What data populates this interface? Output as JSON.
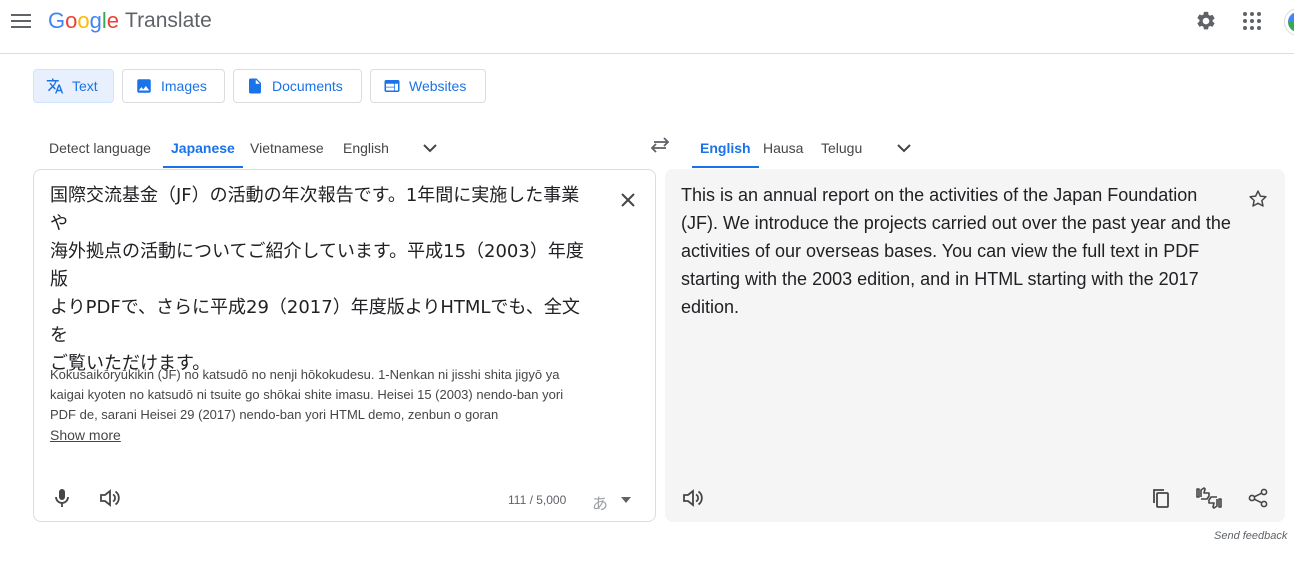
{
  "header": {
    "logo_letters": [
      {
        "ch": "G",
        "color": "#4285f4"
      },
      {
        "ch": "o",
        "color": "#ea4335"
      },
      {
        "ch": "o",
        "color": "#fbbc04"
      },
      {
        "ch": "g",
        "color": "#4285f4"
      },
      {
        "ch": "l",
        "color": "#34a853"
      },
      {
        "ch": "e",
        "color": "#ea4335"
      }
    ],
    "product": "Translate",
    "icons": [
      "menu-icon",
      "settings-icon",
      "apps-grid-icon",
      "account-avatar"
    ]
  },
  "modes": [
    {
      "label": "Text",
      "icon": "translate-icon",
      "active": true
    },
    {
      "label": "Images",
      "icon": "image-icon",
      "active": false
    },
    {
      "label": "Documents",
      "icon": "document-icon",
      "active": false
    },
    {
      "label": "Websites",
      "icon": "website-icon",
      "active": false
    }
  ],
  "source_langs": [
    {
      "label": "Detect language",
      "active": false
    },
    {
      "label": "Japanese",
      "active": true
    },
    {
      "label": "Vietnamese",
      "active": false
    },
    {
      "label": "English",
      "active": false
    }
  ],
  "target_langs": [
    {
      "label": "English",
      "active": true
    },
    {
      "label": "Hausa",
      "active": false
    },
    {
      "label": "Telugu",
      "active": false
    }
  ],
  "source": {
    "lines": [
      "国際交流基金（JF）の活動の年次報告です。1年間に実施した事業や",
      "海外拠点の活動についてご紹介しています。平成15（2003）年度版",
      "よりPDFで、さらに平成29（2017）年度版よりHTMLでも、全文を",
      "ご覧いただけます。"
    ],
    "transliteration_lines": [
      "Kokusaikōryūkikin (JF) no katsudō no nenji hōkokudesu. 1-Nenkan ni jisshi shita jigyō ya",
      "kaigai kyoten no katsudō ni tsuite go shōkai shite imasu. Heisei 15 (2003) nendo-ban yori",
      "PDF de, sarani Heisei 29 (2017) nendo-ban yori HTML demo, zenbun o goran"
    ],
    "show_more": "Show more",
    "char_count": "111 / 5,000",
    "ime_char": "あ"
  },
  "target": {
    "lines": [
      "This is an annual report on the activities of the Japan Foundation",
      "(JF). We introduce the projects carried out over the past year and the",
      "activities of our overseas bases. You can view the full text in PDF",
      "starting with the 2003 edition, and in HTML starting with the 2017",
      "edition."
    ]
  },
  "footer": {
    "feedback": "Send feedback"
  },
  "colors": {
    "accent": "#1a73e8",
    "active_tab_bg": "#e8f0fe",
    "panel_bg": "#f5f5f5",
    "icon_gray": "#5f6368"
  }
}
